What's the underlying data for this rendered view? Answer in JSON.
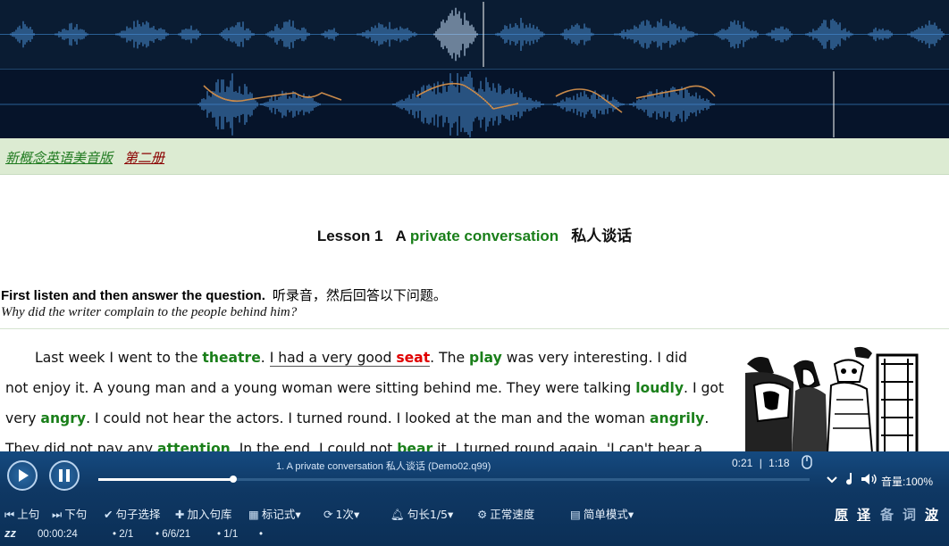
{
  "breadcrumb": {
    "course": "新概念英语美音版",
    "book": "第二册"
  },
  "lesson": {
    "number": "Lesson 1",
    "title_prefix": "A",
    "title_en": "private conversation",
    "title_cn": "私人谈话"
  },
  "instructions": {
    "en": "First listen and then answer the question.",
    "cn": "听录音，然后回答以下问题。",
    "question": "Why did the writer complain to the people behind him?"
  },
  "text_lines": [
    [
      {
        "t": "Last week I went to the "
      },
      {
        "t": "theatre",
        "s": "g"
      },
      {
        "t": ". "
      },
      {
        "t": "I had a very good ",
        "s": "ul"
      },
      {
        "t": "seat",
        "s": "r ul"
      },
      {
        "t": ". The "
      },
      {
        "t": "play",
        "s": "g"
      },
      {
        "t": " was very interesting. I did"
      }
    ],
    [
      {
        "t": "not enjoy it. A young man and a young woman were sitting behind me. They were talking "
      },
      {
        "t": "loudly",
        "s": "g"
      },
      {
        "t": ". I got"
      }
    ],
    [
      {
        "t": "very "
      },
      {
        "t": "angry",
        "s": "g"
      },
      {
        "t": ". I could not hear the actors. I turned round. I looked at the man and the woman "
      },
      {
        "t": "angrily",
        "s": "g"
      },
      {
        "t": "."
      }
    ],
    [
      {
        "t": "They did not pay any "
      },
      {
        "t": "attention",
        "s": "g"
      },
      {
        "t": ". In the end, I could not "
      },
      {
        "t": "bear",
        "s": "g"
      },
      {
        "t": " it. I turned round again. 'I can't hear a"
      }
    ]
  ],
  "player": {
    "track_title": "1. A private conversation 私人谈话 (Demo02.q99)",
    "current_time": "0:21",
    "separator": "|",
    "total_time": "1:18",
    "progress": 0.19,
    "volume_label": "音量:100%"
  },
  "toolbar": {
    "prev": "上句",
    "next": "下句",
    "select": "句子选择",
    "add": "加入句库",
    "mark": "标记式",
    "repeat": "1次",
    "length": "句长1/5",
    "speed": "正常速度",
    "mode": "简单模式"
  },
  "view_modes": [
    "原",
    "译",
    "备",
    "词",
    "波"
  ],
  "status": {
    "sleep": "zz",
    "elapsed": "00:00:24",
    "a": "2/1",
    "b": "6/6/21",
    "c": "1/1"
  },
  "colors": {
    "accent_green": "#1a7f1a",
    "highlight_red": "#e00000",
    "player_bg": "#0f3864"
  },
  "icons": [
    "play-icon",
    "pause-icon",
    "prev-icon",
    "next-icon",
    "check-icon",
    "plus-icon",
    "grid-icon",
    "repeat-icon",
    "bell-icon",
    "gear-icon",
    "chart-icon",
    "volume-icon",
    "mouse-icon",
    "note-icon"
  ]
}
